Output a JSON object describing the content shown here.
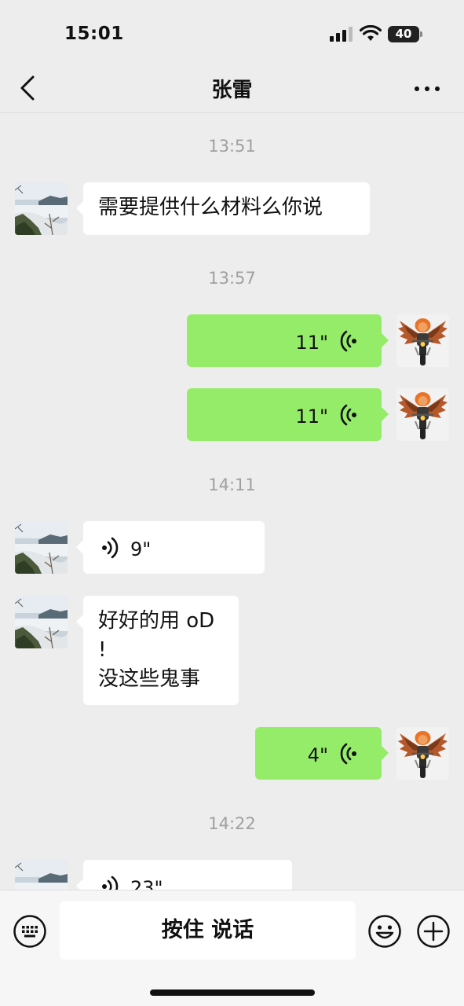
{
  "status_bar": {
    "time": "15:01",
    "battery": "40",
    "icons": [
      "signal-icon",
      "wifi-icon",
      "battery-icon"
    ]
  },
  "nav": {
    "back_icon": "chevron-left-icon",
    "title": "张雷",
    "more_icon": "more-dots-icon"
  },
  "chat": {
    "timestamps": [
      "13:51",
      "13:57",
      "14:11",
      "14:22"
    ],
    "messages": [
      {
        "side": "in",
        "type": "text",
        "text": "需要提供什么材料么你说"
      },
      {
        "side": "out",
        "type": "voice",
        "duration": "11\""
      },
      {
        "side": "out",
        "type": "voice",
        "duration": "11\""
      },
      {
        "side": "in",
        "type": "voice",
        "duration": "9\""
      },
      {
        "side": "in",
        "type": "text",
        "text": "好好的用 oD\n!\n没这些鬼事"
      },
      {
        "side": "out",
        "type": "voice",
        "duration": "4\""
      },
      {
        "side": "in",
        "type": "voice",
        "duration": "23\""
      }
    ]
  },
  "input_bar": {
    "keyboard_icon": "keyboard-icon",
    "hold_to_talk": "按住 说话",
    "emoji_icon": "emoji-icon",
    "plus_icon": "plus-circle-icon"
  },
  "colors": {
    "background": "#ededed",
    "incoming_bubble": "#ffffff",
    "outgoing_bubble": "#95ec69",
    "timestamp": "#a0a0a0"
  }
}
